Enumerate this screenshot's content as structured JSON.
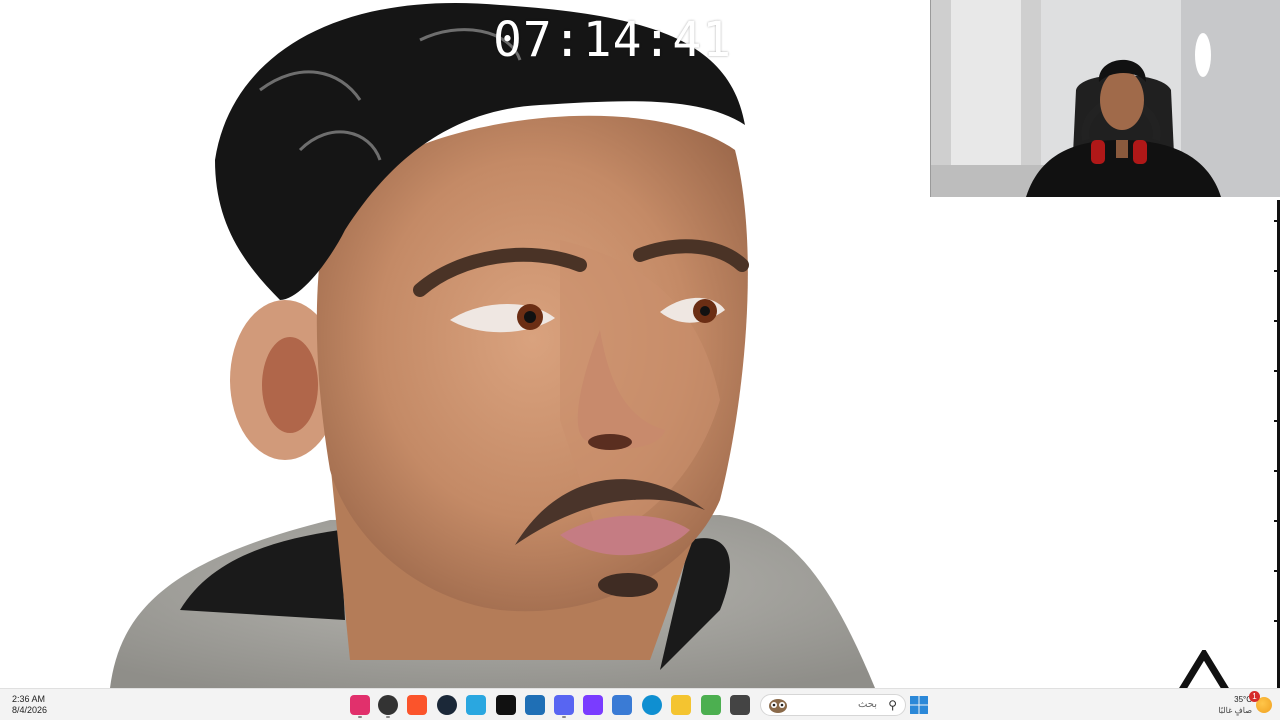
{
  "overlay": {
    "timer": "07:14:41"
  },
  "taskbar": {
    "time": "2:36 AM",
    "date": "8/4/2026",
    "search_placeholder": "بحث",
    "apps": [
      {
        "name": "instagram-icon",
        "color": "#e1306c"
      },
      {
        "name": "app-icon-2",
        "color": "#333333"
      },
      {
        "name": "brave-icon",
        "color": "#fb542b"
      },
      {
        "name": "steam-icon",
        "color": "#1b2838"
      },
      {
        "name": "app-icon-5",
        "color": "#2aa7e0"
      },
      {
        "name": "capcut-icon",
        "color": "#111111"
      },
      {
        "name": "app-icon-7",
        "color": "#1f6fb5"
      },
      {
        "name": "discord-icon",
        "color": "#5865f2"
      },
      {
        "name": "app-icon-9",
        "color": "#7a3cff"
      },
      {
        "name": "app-icon-10",
        "color": "#3a7bd5"
      },
      {
        "name": "edge-icon",
        "color": "#0f8fd1"
      },
      {
        "name": "file-explorer-icon",
        "color": "#f4c430"
      },
      {
        "name": "app-icon-13",
        "color": "#4caf50"
      },
      {
        "name": "app-icon-14",
        "color": "#444444"
      }
    ],
    "start_color": "#2b88d8"
  },
  "weather": {
    "temperature": "35°C",
    "condition": "صافٍ غالبًا",
    "notification_count": "1"
  }
}
